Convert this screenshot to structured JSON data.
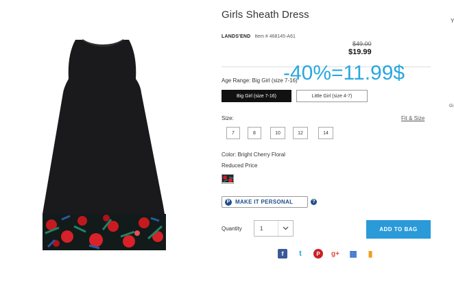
{
  "product": {
    "title": "Girls Sheath Dress",
    "brand": "LANDS'END",
    "item_number": "Item # 468145-A61",
    "old_price": "$49.00",
    "new_price": "$19.99"
  },
  "overlay": {
    "text": "-40%=11.99$",
    "color": "#2aa7df"
  },
  "age_range": {
    "label": "Age Range: Big Girl (size 7-16)",
    "options": [
      "Big Girl (size 7-16)",
      "Little Girl (size 4-7)"
    ],
    "selected": "Big Girl (size 7-16)"
  },
  "size": {
    "label": "Size:",
    "fit_link": "Fit & Size",
    "options": [
      "7",
      "8",
      "10",
      "12",
      "14"
    ]
  },
  "color": {
    "label": "Color: Bright Cherry Floral",
    "reduced": "Reduced Price"
  },
  "personalize": {
    "label": "MAKE IT PERSONAL",
    "icon": "P",
    "help": "?"
  },
  "quantity": {
    "label": "Quantity",
    "value": "1"
  },
  "add_to_bag": {
    "label": "ADD TO BAG",
    "color": "#2a9ad9"
  },
  "social": [
    {
      "name": "facebook-icon",
      "glyph": "f",
      "color": "#3b5998"
    },
    {
      "name": "twitter-icon",
      "glyph": "t",
      "color": "#1da1f2"
    },
    {
      "name": "pinterest-icon",
      "glyph": "P",
      "color": "#cb2027"
    },
    {
      "name": "google-plus-icon",
      "glyph": "g+",
      "color": "#dd4b39"
    },
    {
      "name": "delicious-icon",
      "glyph": "▦",
      "color": "#3274d1"
    },
    {
      "name": "bookmark-icon",
      "glyph": "▮",
      "color": "#f39c12"
    }
  ],
  "edge": {
    "right_top": "Y",
    "right_mid": "Gi"
  }
}
